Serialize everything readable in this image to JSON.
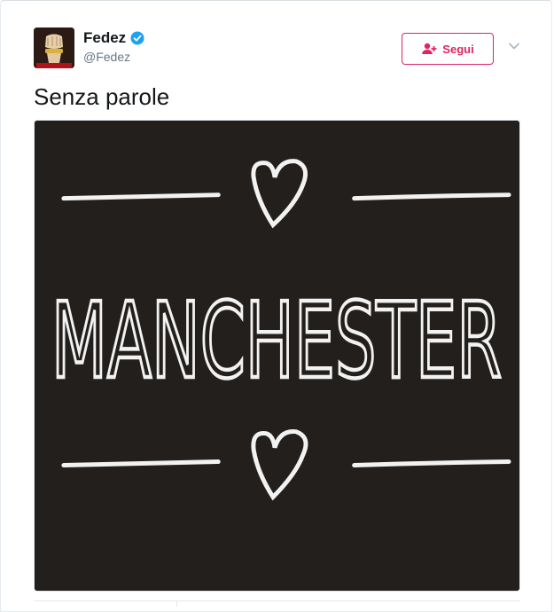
{
  "author": {
    "name": "Fedez",
    "handle": "@Fedez",
    "avatar_icon": "fist-with-chain-photo",
    "verified": true
  },
  "follow_button": {
    "label": "Segui",
    "icon": "add-user-icon",
    "color": "#e0245e"
  },
  "menu_caret_icon": "chevron-down-icon",
  "tweet": {
    "text": "Senza parole"
  },
  "media": {
    "word": "MANCHESTER",
    "background": "#221f1c",
    "ink": "#f2f2f2"
  }
}
